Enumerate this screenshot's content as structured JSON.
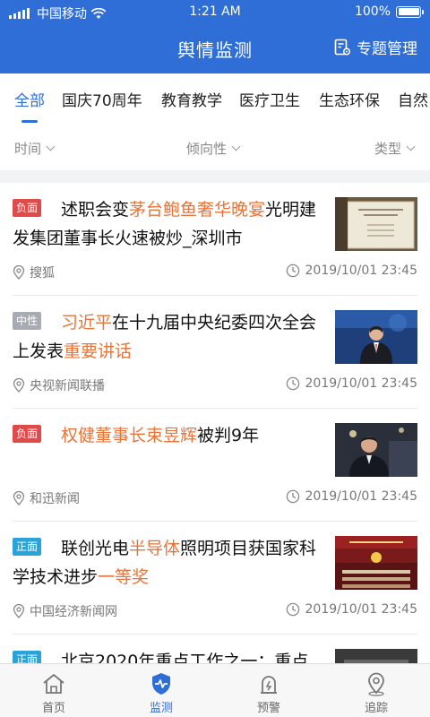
{
  "status_bar": {
    "carrier": "中国移动",
    "time": "1:21 AM",
    "battery": "100%"
  },
  "header": {
    "title": "舆情监测",
    "topic_button": "专题管理"
  },
  "tabs": [
    "全部",
    "国庆70周年",
    "教育教学",
    "医疗卫生",
    "生态环保",
    "自然"
  ],
  "filters": {
    "time": "时间",
    "tendency": "倾向性",
    "type": "类型"
  },
  "news": [
    {
      "tag": "负面",
      "segments": [
        {
          "text": "述职会变",
          "hl": false
        },
        {
          "text": "茅台鲍鱼奢华晚宴",
          "hl": true
        },
        {
          "text": "光明建发集团董事长火速被炒_深圳市",
          "hl": false
        }
      ],
      "source": "搜狐",
      "time": "2019/10/01 23:45"
    },
    {
      "tag": "中性",
      "segments": [
        {
          "text": "习近平",
          "hl": true
        },
        {
          "text": "在十九届中央纪委四次全会上发表",
          "hl": false
        },
        {
          "text": "重要讲话",
          "hl": true
        }
      ],
      "source": "央视新闻联播",
      "time": "2019/10/01 23:45"
    },
    {
      "tag": "负面",
      "segments": [
        {
          "text": "权健董事长束昱辉",
          "hl": true
        },
        {
          "text": "被判9年",
          "hl": false
        }
      ],
      "source": "和迅新闻",
      "time": "2019/10/01 23:45"
    },
    {
      "tag": "正面",
      "segments": [
        {
          "text": "联创光电",
          "hl": false
        },
        {
          "text": "半导体",
          "hl": true
        },
        {
          "text": "照明项目获国家科学技术进步",
          "hl": false
        },
        {
          "text": "一等奖",
          "hl": true
        }
      ],
      "source": "中国经济新闻网",
      "time": "2019/10/01 23:45"
    },
    {
      "tag": "正面",
      "segments": [
        {
          "text": "北京2020年重点工作之一：重点",
          "hl": false
        }
      ],
      "source": "",
      "time": ""
    }
  ],
  "tabbar": [
    "首页",
    "监测",
    "预警",
    "追踪"
  ],
  "colors": {
    "brand": "#2f6ed6",
    "negative": "#e14a4a",
    "neutral": "#a7abb3",
    "positive": "#2aa3d8",
    "highlight": "#e8743a"
  }
}
